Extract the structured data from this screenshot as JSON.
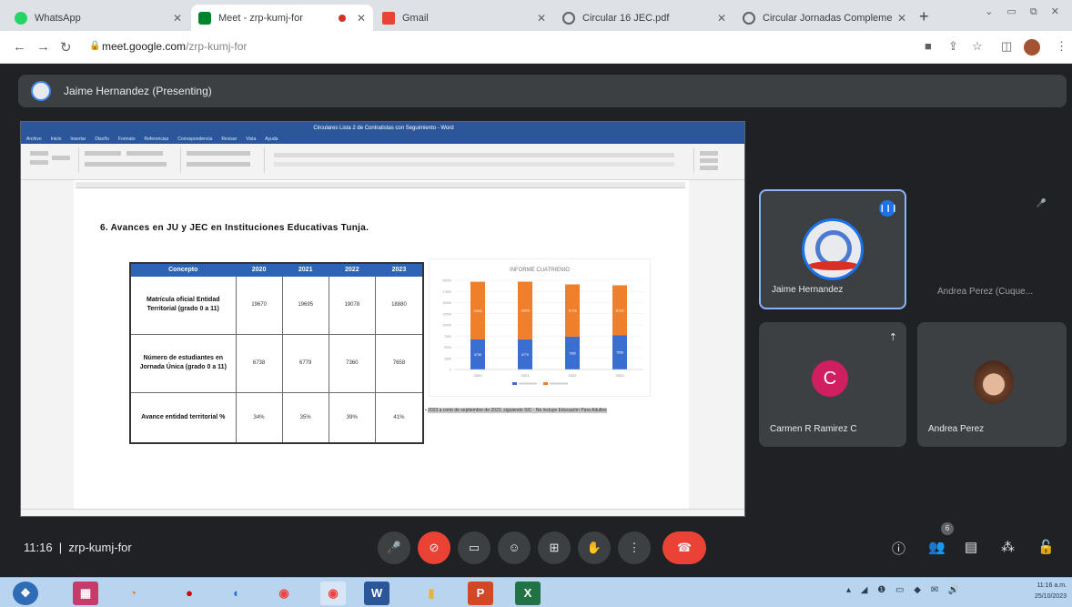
{
  "browser": {
    "tabs": [
      {
        "title": "WhatsApp",
        "favicon_color": "#25d366"
      },
      {
        "title": "Meet - zrp-kumj-for",
        "favicon_color": "#00832d"
      },
      {
        "title": "Gmail",
        "favicon_color": "#ea4335"
      },
      {
        "title": "Circular 16 JEC.pdf",
        "favicon_color": "#5f6368"
      },
      {
        "title": "Circular Jornadas Complementarias",
        "favicon_color": "#5f6368"
      }
    ],
    "url_host": "meet.google.com",
    "url_path": "/zrp-kumj-for"
  },
  "presenter_bar": {
    "label": "Jaime Hernandez (Presenting)"
  },
  "shared_doc": {
    "window_title": "Circulares Lista 2 de Contratistas con Seguimiento - Word",
    "menu": [
      "Archivo",
      "Inicio",
      "Insertar",
      "Diseño",
      "Formato",
      "Referencias",
      "Correspondencia",
      "Revisar",
      "Vista",
      "Ayuda"
    ],
    "heading": "6.  Avances  en  JU  y JEC en  Instituciones Educativas  Tunja.",
    "table": {
      "headers": [
        "Concepto",
        "2020",
        "2021",
        "2022",
        "2023"
      ],
      "rows": [
        {
          "label": "Matrícula oficial Entidad Territorial (grado 0 a 11)",
          "values": [
            "19670",
            "19695",
            "19078",
            "18880"
          ]
        },
        {
          "label": "Número de estudiantes en Jornada Única (grado 0 a 11)",
          "values": [
            "6738",
            "6779",
            "7360",
            "7658"
          ]
        },
        {
          "label": "Avance entidad territorial %",
          "values": [
            "34%",
            "35%",
            "39%",
            "41%"
          ]
        }
      ]
    },
    "note": "2023 a corte de septiembre de 2023, siguiendo SIC - No incluye Educación Para Adultos"
  },
  "chart_data": {
    "type": "bar",
    "title": "INFORME CUATRIENIO",
    "categories": [
      "2020",
      "2021",
      "2022",
      "2023"
    ],
    "series": [
      {
        "values": [
          6738,
          6779,
          7360,
          7658
        ],
        "color": "#3a6ed0"
      },
      {
        "values": [
          12932,
          12916,
          11718,
          11222
        ],
        "color": "#f07f2c"
      }
    ],
    "stacked": true,
    "ylim": [
      0,
      20000
    ]
  },
  "participants": [
    {
      "name": "Jaime Hernandez",
      "speaking": true
    },
    {
      "name": "Andrea Perez (Cuque..."
    },
    {
      "name": "Carmen R Ramirez C",
      "initial": "C"
    },
    {
      "name": "Andrea Perez"
    }
  ],
  "meeting": {
    "time": "11:16",
    "code": "zrp-kumj-for",
    "people_count": "6"
  },
  "taskbar": {
    "clock_time": "11:16 a.m.",
    "clock_date": "25/10/2023"
  }
}
